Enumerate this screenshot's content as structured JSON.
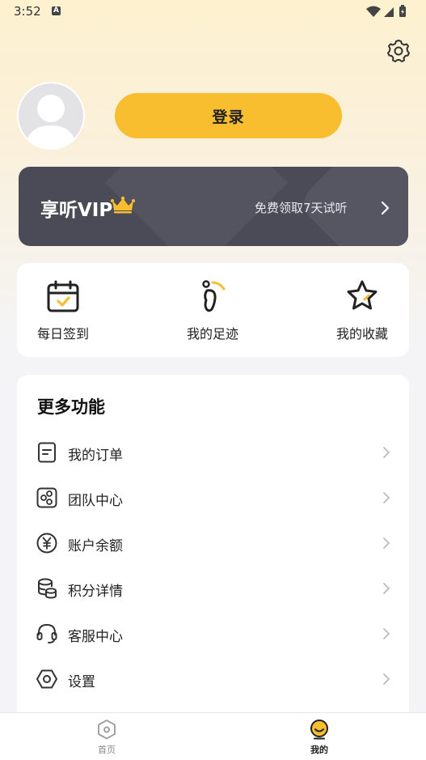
{
  "status_bar": {
    "time": "3:52",
    "notification_icon": "A"
  },
  "header": {
    "settings_icon": "gear-icon"
  },
  "profile": {
    "login_label": "登录"
  },
  "vip": {
    "title": "享听VIP",
    "trial_text": "免费领取7天试听",
    "accent": "#f8be30"
  },
  "quick_actions": [
    {
      "label": "每日签到",
      "icon": "calendar-check-icon"
    },
    {
      "label": "我的足迹",
      "icon": "footprint-icon"
    },
    {
      "label": "我的收藏",
      "icon": "star-icon"
    }
  ],
  "more": {
    "title": "更多功能",
    "items": [
      {
        "label": "我的订单",
        "icon": "order-icon"
      },
      {
        "label": "团队中心",
        "icon": "team-icon"
      },
      {
        "label": "账户余额",
        "icon": "yuan-icon"
      },
      {
        "label": "积分详情",
        "icon": "coins-icon"
      },
      {
        "label": "客服中心",
        "icon": "headset-icon"
      },
      {
        "label": "设置",
        "icon": "settings-hex-icon"
      }
    ]
  },
  "tabs": [
    {
      "label": "首页",
      "active": false
    },
    {
      "label": "我的",
      "active": true
    }
  ],
  "colors": {
    "primary": "#f8be30",
    "vip_bg": "#4a4b57",
    "page_bg": "#f4f4f6"
  }
}
